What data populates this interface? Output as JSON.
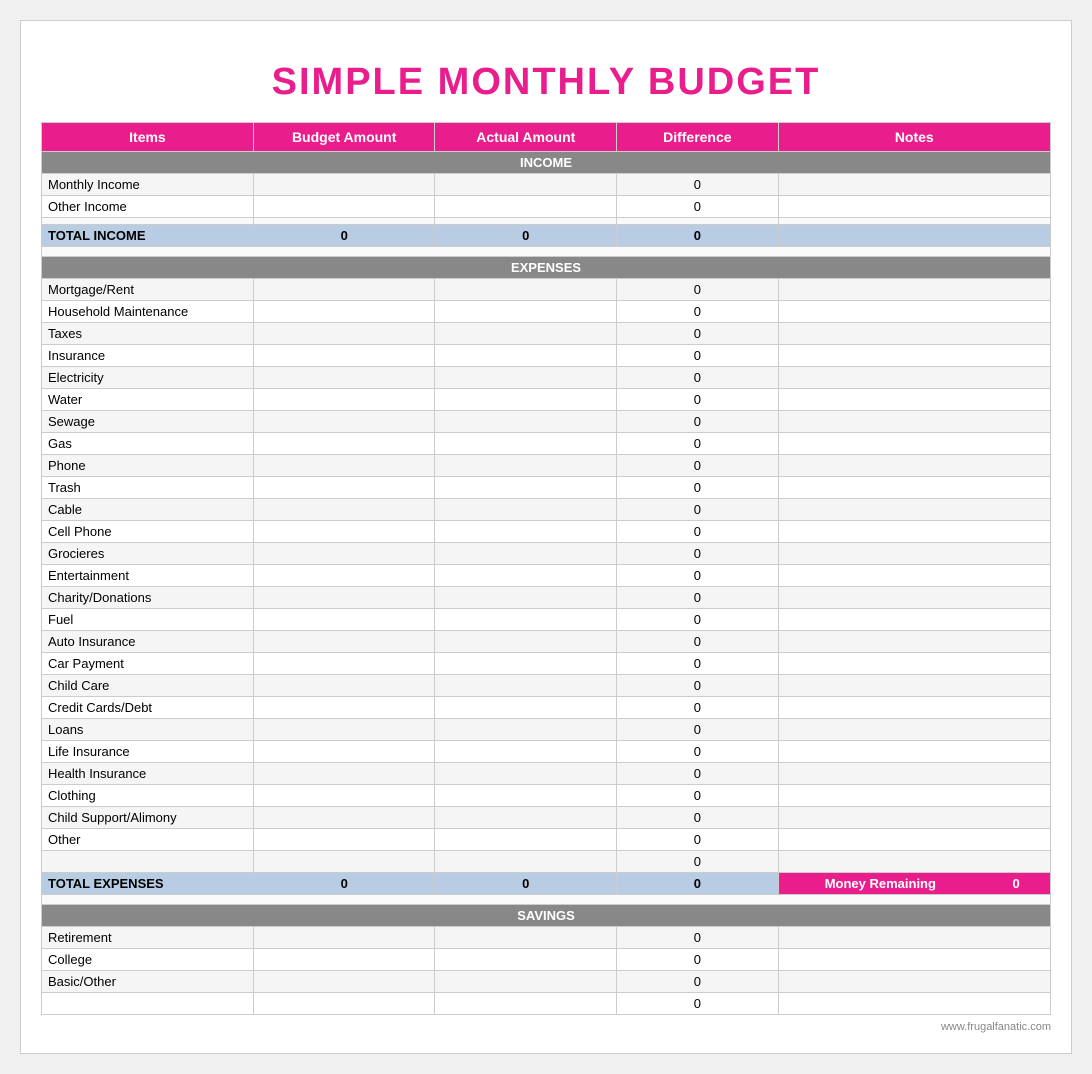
{
  "title": "SIMPLE MONTHLY BUDGET",
  "headers": {
    "items": "Items",
    "budget": "Budget Amount",
    "actual": "Actual Amount",
    "difference": "Difference",
    "notes": "Notes"
  },
  "sections": {
    "income": {
      "label": "INCOME",
      "rows": [
        {
          "item": "Monthly Income",
          "budget": "",
          "actual": "",
          "diff": "0",
          "notes": ""
        },
        {
          "item": "Other Income",
          "budget": "",
          "actual": "",
          "diff": "0",
          "notes": ""
        }
      ],
      "total": {
        "label": "TOTAL INCOME",
        "budget": "0",
        "actual": "0",
        "diff": "0"
      }
    },
    "expenses": {
      "label": "EXPENSES",
      "rows": [
        {
          "item": "Mortgage/Rent",
          "budget": "",
          "actual": "",
          "diff": "0",
          "notes": ""
        },
        {
          "item": "Household Maintenance",
          "budget": "",
          "actual": "",
          "diff": "0",
          "notes": ""
        },
        {
          "item": "Taxes",
          "budget": "",
          "actual": "",
          "diff": "0",
          "notes": ""
        },
        {
          "item": "Insurance",
          "budget": "",
          "actual": "",
          "diff": "0",
          "notes": ""
        },
        {
          "item": "Electricity",
          "budget": "",
          "actual": "",
          "diff": "0",
          "notes": ""
        },
        {
          "item": "Water",
          "budget": "",
          "actual": "",
          "diff": "0",
          "notes": ""
        },
        {
          "item": "Sewage",
          "budget": "",
          "actual": "",
          "diff": "0",
          "notes": ""
        },
        {
          "item": "Gas",
          "budget": "",
          "actual": "",
          "diff": "0",
          "notes": ""
        },
        {
          "item": "Phone",
          "budget": "",
          "actual": "",
          "diff": "0",
          "notes": ""
        },
        {
          "item": "Trash",
          "budget": "",
          "actual": "",
          "diff": "0",
          "notes": ""
        },
        {
          "item": "Cable",
          "budget": "",
          "actual": "",
          "diff": "0",
          "notes": ""
        },
        {
          "item": "Cell Phone",
          "budget": "",
          "actual": "",
          "diff": "0",
          "notes": ""
        },
        {
          "item": "Grocieres",
          "budget": "",
          "actual": "",
          "diff": "0",
          "notes": ""
        },
        {
          "item": "Entertainment",
          "budget": "",
          "actual": "",
          "diff": "0",
          "notes": ""
        },
        {
          "item": "Charity/Donations",
          "budget": "",
          "actual": "",
          "diff": "0",
          "notes": ""
        },
        {
          "item": "Fuel",
          "budget": "",
          "actual": "",
          "diff": "0",
          "notes": ""
        },
        {
          "item": "Auto Insurance",
          "budget": "",
          "actual": "",
          "diff": "0",
          "notes": ""
        },
        {
          "item": "Car Payment",
          "budget": "",
          "actual": "",
          "diff": "0",
          "notes": ""
        },
        {
          "item": "Child Care",
          "budget": "",
          "actual": "",
          "diff": "0",
          "notes": ""
        },
        {
          "item": "Credit Cards/Debt",
          "budget": "",
          "actual": "",
          "diff": "0",
          "notes": ""
        },
        {
          "item": "Loans",
          "budget": "",
          "actual": "",
          "diff": "0",
          "notes": ""
        },
        {
          "item": "Life Insurance",
          "budget": "",
          "actual": "",
          "diff": "0",
          "notes": ""
        },
        {
          "item": "Health Insurance",
          "budget": "",
          "actual": "",
          "diff": "0",
          "notes": ""
        },
        {
          "item": "Clothing",
          "budget": "",
          "actual": "",
          "diff": "0",
          "notes": ""
        },
        {
          "item": "Child Support/Alimony",
          "budget": "",
          "actual": "",
          "diff": "0",
          "notes": ""
        },
        {
          "item": "Other",
          "budget": "",
          "actual": "",
          "diff": "0",
          "notes": ""
        },
        {
          "item": "",
          "budget": "",
          "actual": "",
          "diff": "0",
          "notes": ""
        }
      ],
      "total": {
        "label": "TOTAL EXPENSES",
        "budget": "0",
        "actual": "0",
        "diff": "0",
        "remaining_label": "Money Remaining",
        "remaining_value": "0"
      }
    },
    "savings": {
      "label": "SAVINGS",
      "rows": [
        {
          "item": "Retirement",
          "budget": "",
          "actual": "",
          "diff": "0",
          "notes": ""
        },
        {
          "item": "College",
          "budget": "",
          "actual": "",
          "diff": "0",
          "notes": ""
        },
        {
          "item": "Basic/Other",
          "budget": "",
          "actual": "",
          "diff": "0",
          "notes": ""
        },
        {
          "item": "",
          "budget": "",
          "actual": "",
          "diff": "0",
          "notes": ""
        }
      ]
    }
  },
  "footer": "www.frugalfanatic.com"
}
